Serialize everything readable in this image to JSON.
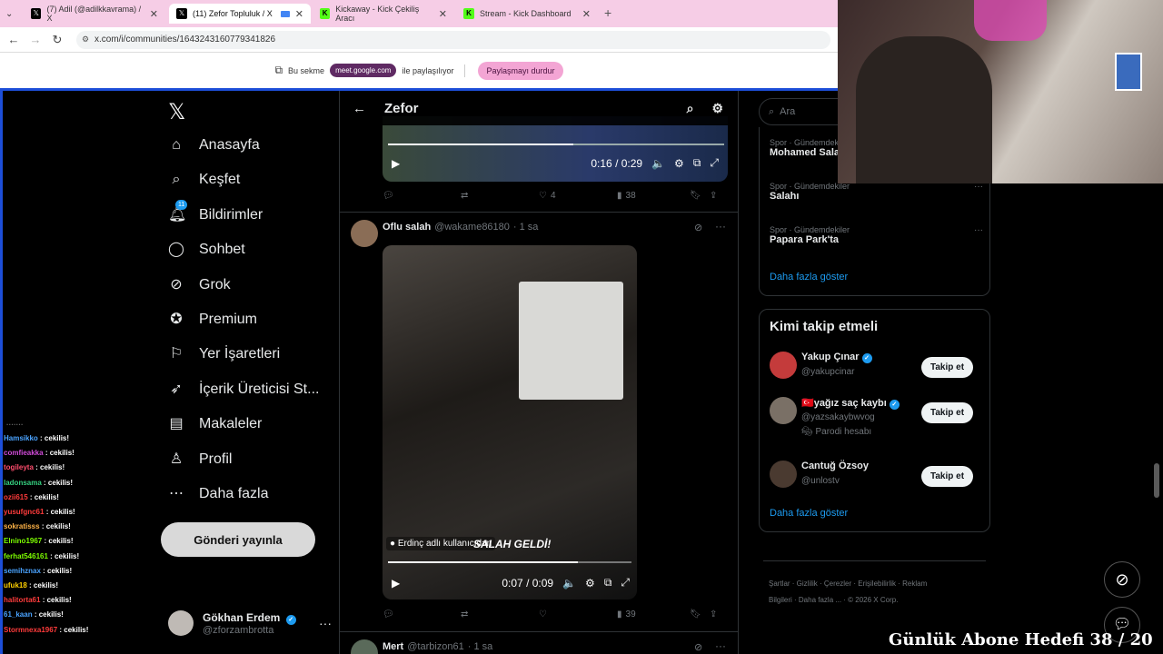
{
  "browser": {
    "tabs": [
      {
        "title": "(7) Adil (@adilkkavrama) / X",
        "icon": "x-logo",
        "active": false
      },
      {
        "title": "(11) Zefor Topluluk / X",
        "icon": "x-logo",
        "active": true
      },
      {
        "title": "Kickaway - Kick Çekiliş Aracı",
        "icon": "kick-logo",
        "active": false
      },
      {
        "title": "Stream - Kick Dashboard",
        "icon": "kick-logo",
        "active": false
      }
    ],
    "url": "x.com/i/communities/1643243160779341826"
  },
  "sharebar": {
    "prefix": "Bu sekme",
    "host": "meet.google.com",
    "suffix": "ile paylaşılıyor",
    "stop_label": "Paylaşmayı durdur"
  },
  "nav": {
    "items": [
      {
        "label": "Anasayfa",
        "icon": "home-icon"
      },
      {
        "label": "Keşfet",
        "icon": "search-icon"
      },
      {
        "label": "Bildirimler",
        "icon": "bell-icon",
        "badge": "11"
      },
      {
        "label": "Sohbet",
        "icon": "chat-icon"
      },
      {
        "label": "Grok",
        "icon": "grok-icon"
      },
      {
        "label": "Premium",
        "icon": "premium-icon"
      },
      {
        "label": "Yer İşaretleri",
        "icon": "bookmark-icon"
      },
      {
        "label": "İçerik Üreticisi St...",
        "icon": "rocket-icon"
      },
      {
        "label": "Makaleler",
        "icon": "article-icon"
      },
      {
        "label": "Profil",
        "icon": "profile-icon"
      },
      {
        "label": "Daha fazla",
        "icon": "more-icon"
      }
    ],
    "post_label": "Gönderi yayınla",
    "account": {
      "name": "Gökhan Erdem",
      "handle": "@zforzambrotta"
    }
  },
  "timeline": {
    "title": "Zefor",
    "post1": {
      "time": "0:16 / 0:29",
      "likes": "4",
      "views": "38"
    },
    "post2": {
      "name": "Oflu salah",
      "handle": "@wakame86180",
      "age": "· 1 sa",
      "video_caption": "Erdinç adlı kullanıcıdan",
      "video_banner": "SALAH GELDİ!",
      "time": "0:07 / 0:09",
      "views": "39"
    },
    "post3": {
      "name": "Mert",
      "handle": "@tarbizon61",
      "age": "· 1 sa"
    }
  },
  "right": {
    "search_placeholder": "Ara",
    "trends": [
      {
        "category": "Spor · Gündemdekiler",
        "name": "Mohamed Salah"
      },
      {
        "category": "Spor · Gündemdekiler",
        "name": "Salahı"
      },
      {
        "category": "Spor · Gündemdekiler",
        "name": "Papara Park'ta"
      }
    ],
    "trends_more": "Daha fazla göster",
    "who_to_follow_title": "Kimi takip etmeli",
    "suggestions": [
      {
        "name": "Yakup Çınar",
        "handle": "@yakupcinar",
        "note": ""
      },
      {
        "name": "🇹🇷yağız saç kaybı",
        "handle": "@yazsakaybwvog",
        "note": "Parodi hesabı"
      },
      {
        "name": "Cantuğ Özsoy",
        "handle": "@unlostv",
        "note": ""
      }
    ],
    "follow_label": "Takip et",
    "follow_more": "Daha fazla göster",
    "footer": [
      "Şartlar",
      "Gizlilik",
      "Çerezler",
      "Erişilebilirlik",
      "Reklam Bilgileri",
      "Daha fazla ...",
      "© 2026 X Corp."
    ]
  },
  "chat": [
    {
      "user": "Hamsikko",
      "msg": ": cekilis!",
      "color": "#4aa3ff"
    },
    {
      "user": "comfieakka",
      "msg": ": cekilis!",
      "color": "#d04bd8"
    },
    {
      "user": "togileyta",
      "msg": ": cekilis!",
      "color": "#ff4d6d"
    },
    {
      "user": "ladonsama",
      "msg": ": cekilis!",
      "color": "#35d07f"
    },
    {
      "user": "ozii615",
      "msg": ": cekilis!",
      "color": "#ff3b3b"
    },
    {
      "user": "yusufgnc61",
      "msg": ": cekilis!",
      "color": "#ff3b3b"
    },
    {
      "user": "sokratisss",
      "msg": ": cekilis!",
      "color": "#ffb347"
    },
    {
      "user": "Elnino1967",
      "msg": ": cekilis!",
      "color": "#7cfc00"
    },
    {
      "user": "ferhat546161",
      "msg": ": cekilis!",
      "color": "#7cfc00"
    },
    {
      "user": "semihznax",
      "msg": ": cekilis!",
      "color": "#4aa3ff"
    },
    {
      "user": "ufuk18",
      "msg": ": cekilis!",
      "color": "#ffd000"
    },
    {
      "user": "halitorta61",
      "msg": ": cekilis!",
      "color": "#ff3b3b"
    },
    {
      "user": "61_kaan",
      "msg": ": cekilis!",
      "color": "#4aa3ff"
    },
    {
      "user": "Stormnexa1967",
      "msg": ": cekilis!",
      "color": "#ff3b3b"
    }
  ],
  "overlay": {
    "goal_text": "Günlük Abone Hedefi 38 / 20"
  },
  "colors": {
    "x_blue": "#1d9bf0",
    "pink_tabbar": "#f6cde6",
    "share_stop": "#f3a5d4"
  }
}
